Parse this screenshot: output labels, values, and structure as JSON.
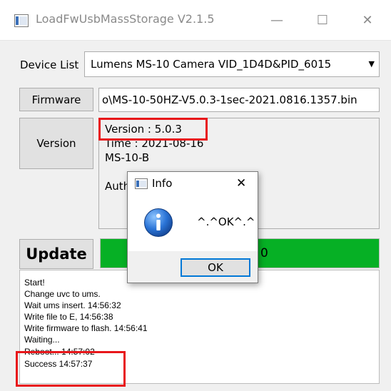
{
  "window": {
    "title": "LoadFwUsbMassStorage V2.1.5",
    "minimize": "—",
    "maximize": "☐",
    "close": "✕"
  },
  "device": {
    "label": "Device List",
    "selected": "Lumens MS-10 Camera    VID_1D4D&PID_6015"
  },
  "firmware": {
    "button": "Firmware",
    "path": "o\\MS-10-50HZ-V5.0.3-1sec-2021.0816.1357.bin"
  },
  "version": {
    "button": "Version",
    "lines": [
      "Version : 5.0.3",
      "Time : 2021-08-16",
      "MS-10-B",
      "",
      "Auth"
    ]
  },
  "update": {
    "button": "Update",
    "progress_text": "0",
    "progress_fraction": 1.0
  },
  "log": {
    "lines": [
      "Start!",
      "Change uvc to ums.",
      "Wait ums insert. 14:56:32",
      "Write file to E, 14:56:38",
      "Write firmware to flash. 14:56:41",
      "Waiting...",
      "Reboot... 14:57:02",
      "Success 14:57:37"
    ]
  },
  "dialog": {
    "title": "Info",
    "close": "✕",
    "message": "^.^OK^.^",
    "ok": "OK",
    "icon": "info-icon"
  },
  "colors": {
    "highlight": "#e8161a",
    "progress": "#06b025",
    "info_blue": "#1b63c6"
  }
}
